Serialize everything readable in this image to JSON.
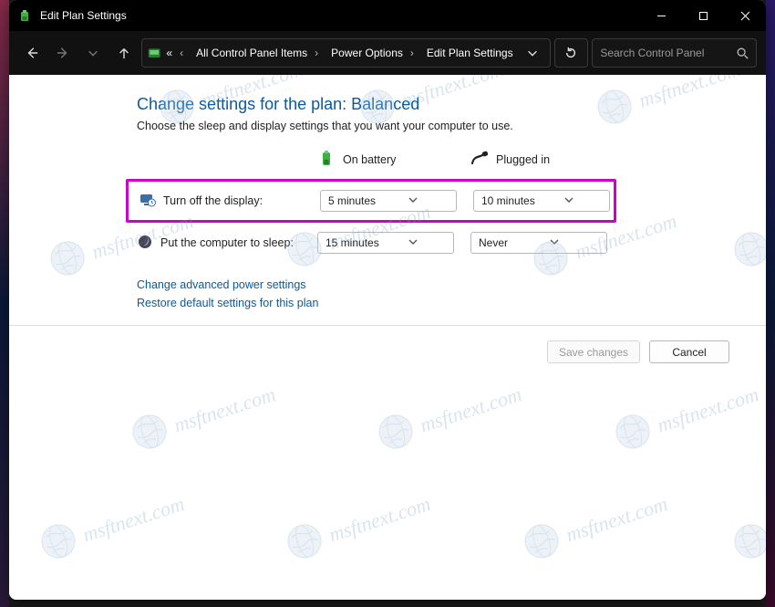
{
  "window": {
    "title": "Edit Plan Settings"
  },
  "nav": {
    "crumbs": [
      "All Control Panel Items",
      "Power Options",
      "Edit Plan Settings"
    ],
    "search_placeholder": "Search Control Panel"
  },
  "page": {
    "heading": "Change settings for the plan: Balanced",
    "subheading": "Choose the sleep and display settings that you want your computer to use.",
    "columns": {
      "battery": "On battery",
      "plugged": "Plugged in"
    },
    "rows": {
      "display": {
        "label": "Turn off the display:",
        "battery": "5 minutes",
        "plugged": "10 minutes",
        "highlighted": true
      },
      "sleep": {
        "label": "Put the computer to sleep:",
        "battery": "15 minutes",
        "plugged": "Never"
      }
    },
    "links": {
      "advanced": "Change advanced power settings",
      "restore": "Restore default settings for this plan"
    },
    "buttons": {
      "save": "Save changes",
      "cancel": "Cancel"
    }
  },
  "watermark_text": "msftnext.com"
}
